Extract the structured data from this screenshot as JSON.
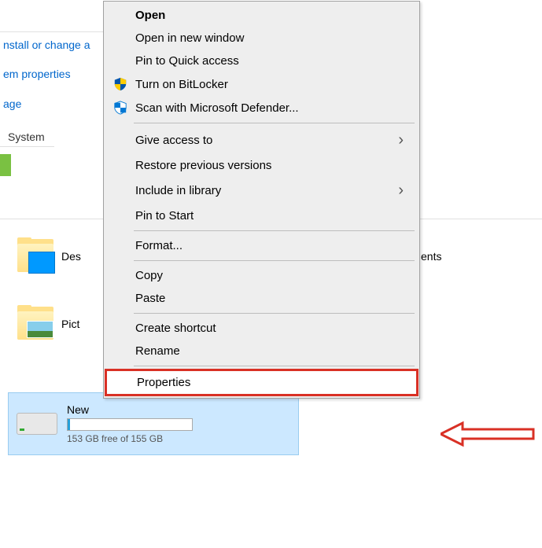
{
  "sidebar": {
    "link1": "nstall or change a",
    "link2": "em properties",
    "link3": "age",
    "tab": "System"
  },
  "folders": {
    "desktop_label": "Des",
    "pictures_label": "Pict",
    "documents_label": "ents"
  },
  "drive": {
    "title": "New",
    "status": "153 GB free of 155 GB"
  },
  "menu": {
    "open": "Open",
    "open_new_window": "Open in new window",
    "pin_quick_access": "Pin to Quick access",
    "turn_on_bitlocker": "Turn on BitLocker",
    "scan_defender": "Scan with Microsoft Defender...",
    "give_access_to": "Give access to",
    "restore_prev": "Restore previous versions",
    "include_library": "Include in library",
    "pin_to_start": "Pin to Start",
    "format": "Format...",
    "copy": "Copy",
    "paste": "Paste",
    "create_shortcut": "Create shortcut",
    "rename": "Rename",
    "properties": "Properties"
  }
}
